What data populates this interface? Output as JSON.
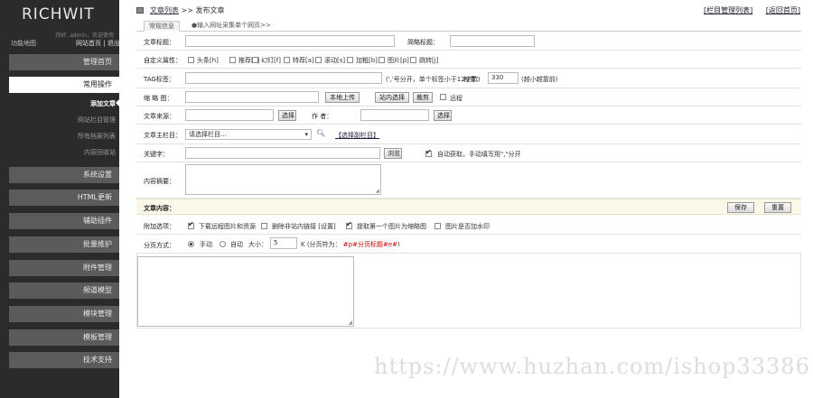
{
  "sidebar": {
    "logo": "RICHWIT",
    "welcome": "你好, admin，欢迎使用",
    "func_map": "功能地图",
    "site_home": "网站首页 | 退出",
    "menu": [
      {
        "label": "管理首页"
      },
      {
        "label": "常用操作"
      },
      {
        "label": "系统设置"
      },
      {
        "label": "HTML更新"
      },
      {
        "label": "辅助插件"
      },
      {
        "label": "批量维护"
      },
      {
        "label": "附件管理"
      },
      {
        "label": "频道模型"
      },
      {
        "label": "模块管理"
      },
      {
        "label": "模板管理"
      },
      {
        "label": "技术支持"
      }
    ],
    "submenu": [
      {
        "label": "添加文章"
      },
      {
        "label": "网站栏目管理"
      },
      {
        "label": "所有档案列表"
      },
      {
        "label": "内容回收站"
      }
    ]
  },
  "topbar": {
    "crumb_link": "文章列表",
    "crumb_sep": ">>",
    "crumb_current": "发布文章",
    "links": [
      "[栏目管理列表]",
      "[返回首页]"
    ]
  },
  "tabs": [
    {
      "label": "常规信息"
    },
    {
      "label": "●输入网址采集单个网页>>"
    }
  ],
  "form": {
    "title_label": "文章标题：",
    "short_title_label": "简略标题：",
    "attr_label": "自定义属性：",
    "attrs": [
      "头条[h]",
      "推荐[c]",
      "幻灯[f]",
      "特荐[a]",
      "滚动[s]",
      "加粗[b]",
      "图片[p]",
      "跳转[j]"
    ],
    "tag_label": "TAG标签：",
    "tag_hint": "(','号分开，单个标签小于12字节)",
    "weight_label": "权重：",
    "weight_value": "330",
    "weight_hint": "(越小越靠前)",
    "thumb_label": "缩 略 图：",
    "upload_button": "本地上传",
    "site_select_button": "站内选择",
    "crop_button": "裁剪",
    "remote_label": "远程",
    "source_label": "文章来源：",
    "source_select": "选择",
    "author_label": "作 者：",
    "author_select": "选择",
    "column_label": "文章主栏目：",
    "column_value": "请选择栏目...",
    "sub_column_link": "【选择副栏目】",
    "keyword_label": "关键字：",
    "browse_button": "浏览",
    "auto_fetch": "自动获取，手动填写用\",\"分开",
    "summary_label": "内容摘要：",
    "content_label": "文章内容：",
    "save_button": "保存",
    "reset_button": "重置",
    "attach_label": "附加选项：",
    "attach_opts": [
      "下载远程图片和资源",
      "删除非站内链接 [设置]",
      "提取第一个图片为缩略图",
      "图片是否加水印"
    ],
    "paging_label": "分页方式：",
    "paging_manual": "手动",
    "paging_auto": "自动",
    "paging_size_label": "大小：",
    "paging_size_value": "5",
    "paging_hint": "K (分页符为：",
    "paging_tag": "#p#分页标题#e#",
    "paging_end": ")"
  },
  "watermark": "https://www.huzhan.com/ishop33386"
}
